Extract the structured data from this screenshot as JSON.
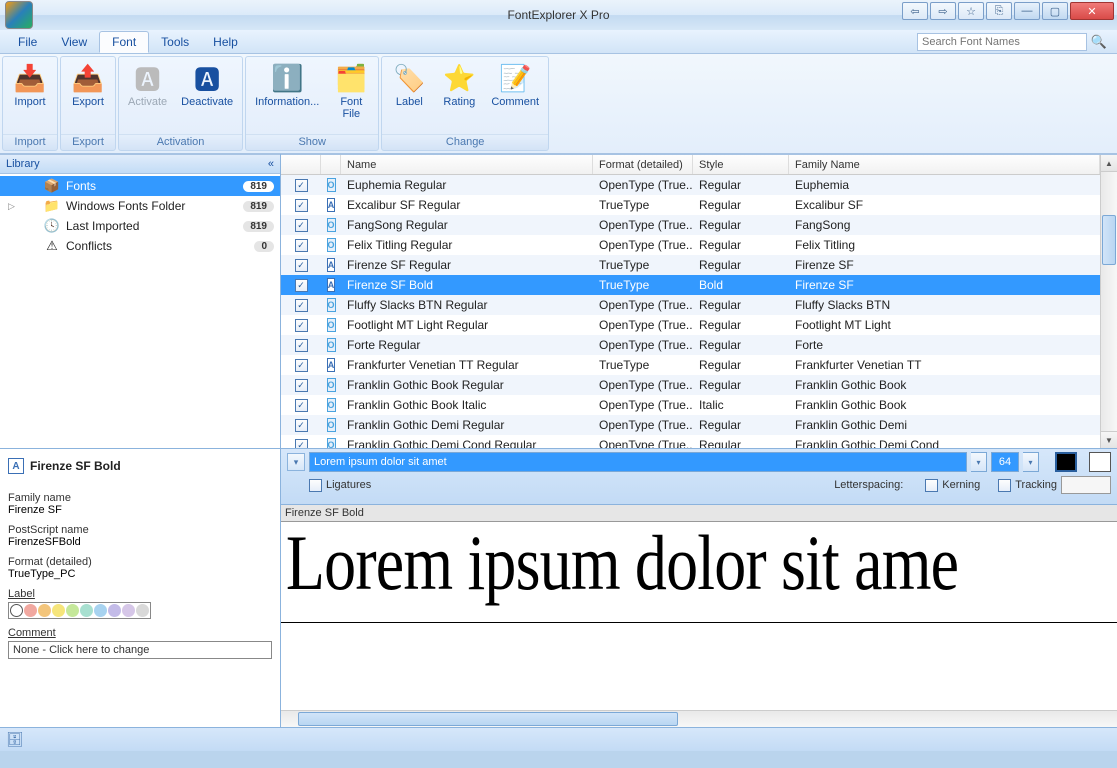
{
  "window": {
    "title": "FontExplorer X Pro"
  },
  "menu": {
    "file": "File",
    "view": "View",
    "font": "Font",
    "tools": "Tools",
    "help": "Help"
  },
  "search": {
    "placeholder": "Search Font Names"
  },
  "ribbon": {
    "groups": {
      "import": {
        "label": "Import",
        "btn_import": "Import"
      },
      "export": {
        "label": "Export",
        "btn_export": "Export"
      },
      "activation": {
        "label": "Activation",
        "btn_activate": "Activate",
        "btn_deactivate": "Deactivate"
      },
      "show": {
        "label": "Show",
        "btn_info": "Information...",
        "btn_fontfile": "Font\nFile"
      },
      "change": {
        "label": "Change",
        "btn_label": "Label",
        "btn_rating": "Rating",
        "btn_comment": "Comment"
      }
    }
  },
  "library": {
    "header": "Library",
    "items": [
      {
        "icon": "📦",
        "label": "Fonts",
        "count": "819",
        "selected": true
      },
      {
        "icon": "📁",
        "label": "Windows Fonts Folder",
        "count": "819"
      },
      {
        "icon": "🕓",
        "label": "Last Imported",
        "count": "819"
      },
      {
        "icon": "⚠",
        "label": "Conflicts",
        "count": "0"
      }
    ]
  },
  "info": {
    "title": "Firenze SF   Bold",
    "family_label": "Family name",
    "family_value": "Firenze SF",
    "ps_label": "PostScript name",
    "ps_value": "FirenzeSFBold",
    "format_label": "Format (detailed)",
    "format_value": "TrueType_PC",
    "label_label": "Label",
    "comment_label": "Comment",
    "comment_value": "None - Click here to change"
  },
  "table": {
    "headers": {
      "name": "Name",
      "format": "Format (detailed)",
      "style": "Style",
      "family": "Family Name"
    },
    "rows": [
      {
        "name": "Euphemia Regular",
        "format": "OpenType (True...",
        "style": "Regular",
        "family": "Euphemia",
        "icon": "O"
      },
      {
        "name": "Excalibur SF Regular",
        "format": "TrueType",
        "style": "Regular",
        "family": "Excalibur SF",
        "icon": "A"
      },
      {
        "name": "FangSong Regular",
        "format": "OpenType (True...",
        "style": "Regular",
        "family": "FangSong",
        "icon": "O"
      },
      {
        "name": "Felix Titling Regular",
        "format": "OpenType (True...",
        "style": "Regular",
        "family": "Felix Titling",
        "icon": "O"
      },
      {
        "name": "Firenze SF Regular",
        "format": "TrueType",
        "style": "Regular",
        "family": "Firenze SF",
        "icon": "A"
      },
      {
        "name": "Firenze SF   Bold",
        "format": "TrueType",
        "style": "Bold",
        "family": "Firenze SF",
        "icon": "A",
        "selected": true
      },
      {
        "name": "Fluffy Slacks BTN Regular",
        "format": "OpenType (True...",
        "style": "Regular",
        "family": "Fluffy Slacks BTN",
        "icon": "O"
      },
      {
        "name": "Footlight MT Light Regular",
        "format": "OpenType (True...",
        "style": "Regular",
        "family": "Footlight MT Light",
        "icon": "O"
      },
      {
        "name": "Forte Regular",
        "format": "OpenType (True...",
        "style": "Regular",
        "family": "Forte",
        "icon": "O"
      },
      {
        "name": "Frankfurter Venetian TT Regular",
        "format": "TrueType",
        "style": "Regular",
        "family": "Frankfurter Venetian TT",
        "icon": "A"
      },
      {
        "name": "Franklin Gothic Book Regular",
        "format": "OpenType (True...",
        "style": "Regular",
        "family": "Franklin Gothic Book",
        "icon": "O"
      },
      {
        "name": "Franklin Gothic Book Italic",
        "format": "OpenType (True...",
        "style": "Italic",
        "family": "Franklin Gothic Book",
        "icon": "O"
      },
      {
        "name": "Franklin Gothic Demi Regular",
        "format": "OpenType (True...",
        "style": "Regular",
        "family": "Franklin Gothic Demi",
        "icon": "O"
      },
      {
        "name": "Franklin Gothic Demi Cond Regular",
        "format": "OpenType (True...",
        "style": "Regular",
        "family": "Franklin Gothic Demi Cond",
        "icon": "O"
      }
    ]
  },
  "preview": {
    "sample_text": "Lorem ipsum dolor sit amet",
    "size": "64",
    "ligatures": "Ligatures",
    "letterspacing": "Letterspacing:",
    "kerning": "Kerning",
    "tracking": "Tracking",
    "font_label": "Firenze SF   Bold",
    "display_text": "Lorem ipsum dolor sit ame"
  },
  "label_colors": [
    "#ffffff",
    "#f1a8a0",
    "#f3c57b",
    "#f6e57b",
    "#c5e89a",
    "#a8e0d0",
    "#a8d3f0",
    "#c3bbe8",
    "#d6c7e8",
    "#d9d9d9"
  ]
}
